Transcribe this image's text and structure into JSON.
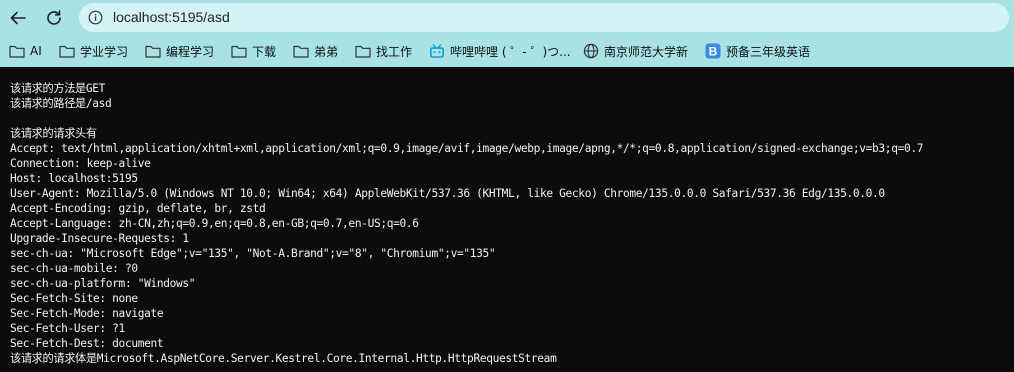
{
  "browser": {
    "url": "localhost:5195/asd"
  },
  "bookmarks": [
    {
      "label": "AI",
      "icon": "folder-icon"
    },
    {
      "label": "学业学习",
      "icon": "folder-icon"
    },
    {
      "label": "编程学习",
      "icon": "folder-icon"
    },
    {
      "label": "下载",
      "icon": "folder-icon"
    },
    {
      "label": "弟弟",
      "icon": "folder-icon"
    },
    {
      "label": "找工作",
      "icon": "folder-icon"
    },
    {
      "label": "哔哩哔哩 ( ゜- ゜)つ...",
      "icon": "bilibili-icon"
    },
    {
      "label": "南京师范大学新",
      "icon": "globe-icon"
    },
    {
      "label": "预备三年级英语",
      "icon": "bing-b-icon"
    }
  ],
  "page": {
    "lines": [
      "该请求的方法是GET",
      "该请求的路径是/asd",
      "",
      "该请求的请求头有",
      "Accept: text/html,application/xhtml+xml,application/xml;q=0.9,image/avif,image/webp,image/apng,*/*;q=0.8,application/signed-exchange;v=b3;q=0.7",
      "Connection: keep-alive",
      "Host: localhost:5195",
      "User-Agent: Mozilla/5.0 (Windows NT 10.0; Win64; x64) AppleWebKit/537.36 (KHTML, like Gecko) Chrome/135.0.0.0 Safari/537.36 Edg/135.0.0.0",
      "Accept-Encoding: gzip, deflate, br, zstd",
      "Accept-Language: zh-CN,zh;q=0.9,en;q=0.8,en-GB;q=0.7,en-US;q=0.6",
      "Upgrade-Insecure-Requests: 1",
      "sec-ch-ua: \"Microsoft Edge\";v=\"135\", \"Not-A.Brand\";v=\"8\", \"Chromium\";v=\"135\"",
      "sec-ch-ua-mobile: ?0",
      "sec-ch-ua-platform: \"Windows\"",
      "Sec-Fetch-Site: none",
      "Sec-Fetch-Mode: navigate",
      "Sec-Fetch-User: ?1",
      "Sec-Fetch-Dest: document",
      "该请求的请求体是Microsoft.AspNetCore.Server.Kestrel.Core.Internal.Http.HttpRequestStream"
    ]
  }
}
